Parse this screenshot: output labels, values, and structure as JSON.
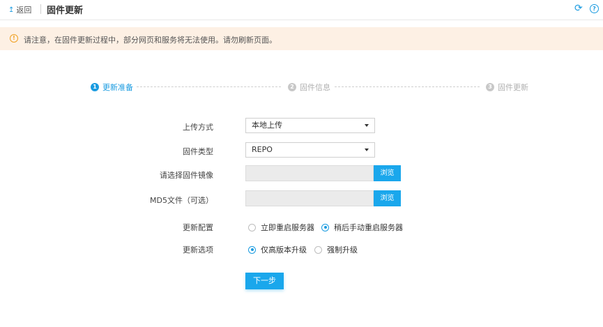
{
  "header": {
    "back_label": "返回",
    "title": "固件更新",
    "icons": {
      "back": "back-arrow-icon",
      "refresh": "refresh-icon",
      "help": "help-icon"
    }
  },
  "notice": {
    "icon": "warning-icon",
    "text": "请注意，在固件更新过程中，部分网页和服务将无法使用。请勿刷新页面。"
  },
  "steps": [
    {
      "number": "1",
      "label": "更新准备",
      "state": "active"
    },
    {
      "number": "2",
      "label": "固件信息",
      "state": "inactive"
    },
    {
      "number": "3",
      "label": "固件更新",
      "state": "inactive"
    }
  ],
  "form": {
    "upload_method": {
      "label": "上传方式",
      "value": "本地上传"
    },
    "firmware_type": {
      "label": "固件类型",
      "value": "REPO"
    },
    "firmware_image": {
      "label": "请选择固件镜像",
      "value": "",
      "browse_label": "浏览"
    },
    "md5_file": {
      "label": "MD5文件（可选）",
      "value": "",
      "browse_label": "浏览"
    },
    "update_config": {
      "label": "更新配置",
      "options": [
        "立即重启服务器",
        "稍后手动重启服务器"
      ],
      "selected": "稍后手动重启服务器"
    },
    "update_option": {
      "label": "更新选项",
      "options": [
        "仅高版本升级",
        "强制升级"
      ],
      "selected": "仅高版本升级"
    },
    "next_label": "下一步"
  },
  "colors": {
    "accent": "#1a9be0",
    "button": "#1aa7ec",
    "notice_bg": "#fdf0e4",
    "warning": "#f0a020"
  }
}
